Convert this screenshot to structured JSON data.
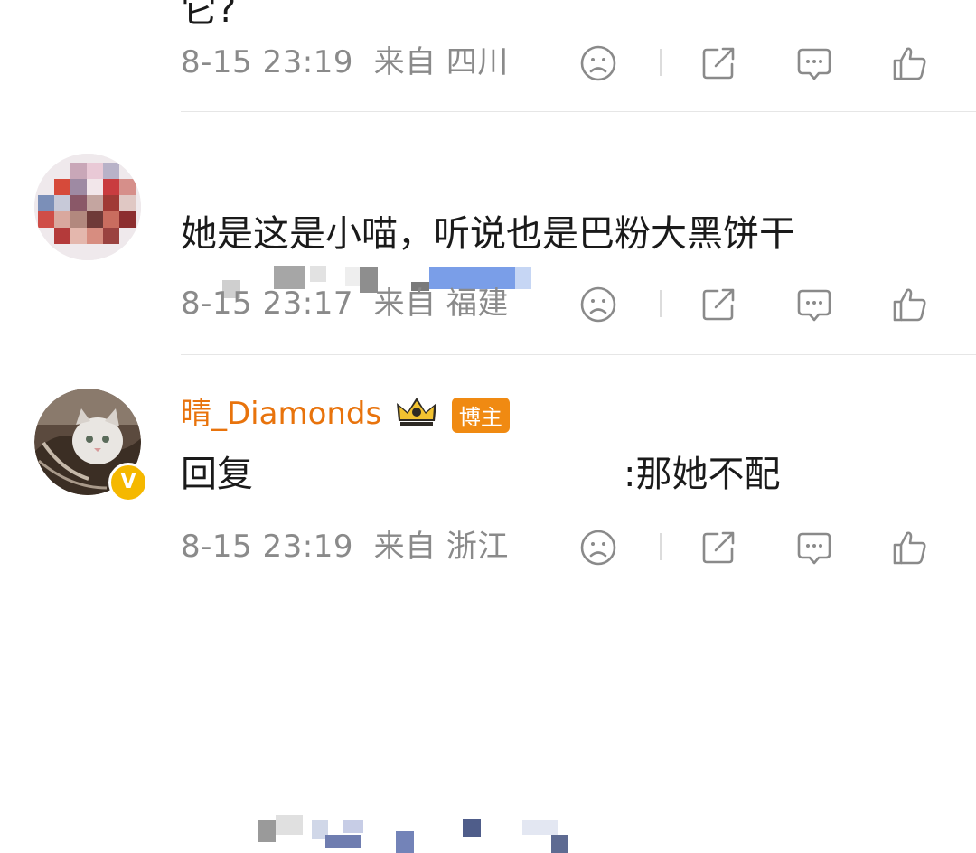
{
  "comments": [
    {
      "text_fragment": "它?",
      "timestamp": "8-15 23:19",
      "location": "来自 四川"
    },
    {
      "username": "",
      "content": "她是这是小喵，听说也是巴粉大黑饼干",
      "timestamp": "8-15 23:17",
      "location": "来自 福建"
    },
    {
      "username": "晴_Diamonds",
      "badge_label": "博主",
      "content_prefix": "回复",
      "content_suffix": ":那她不配",
      "timestamp": "8-15 23:19",
      "location": "来自 浙江"
    }
  ],
  "icons": {
    "dislike": "sad-face-icon",
    "share": "share-icon",
    "comment": "comment-bubble-icon",
    "like": "thumbs-up-icon"
  },
  "colors": {
    "meta_gray": "#8a8a8a",
    "username_orange": "#e8730c",
    "badge_orange": "#f08a12",
    "verified_gold": "#f5b800"
  }
}
